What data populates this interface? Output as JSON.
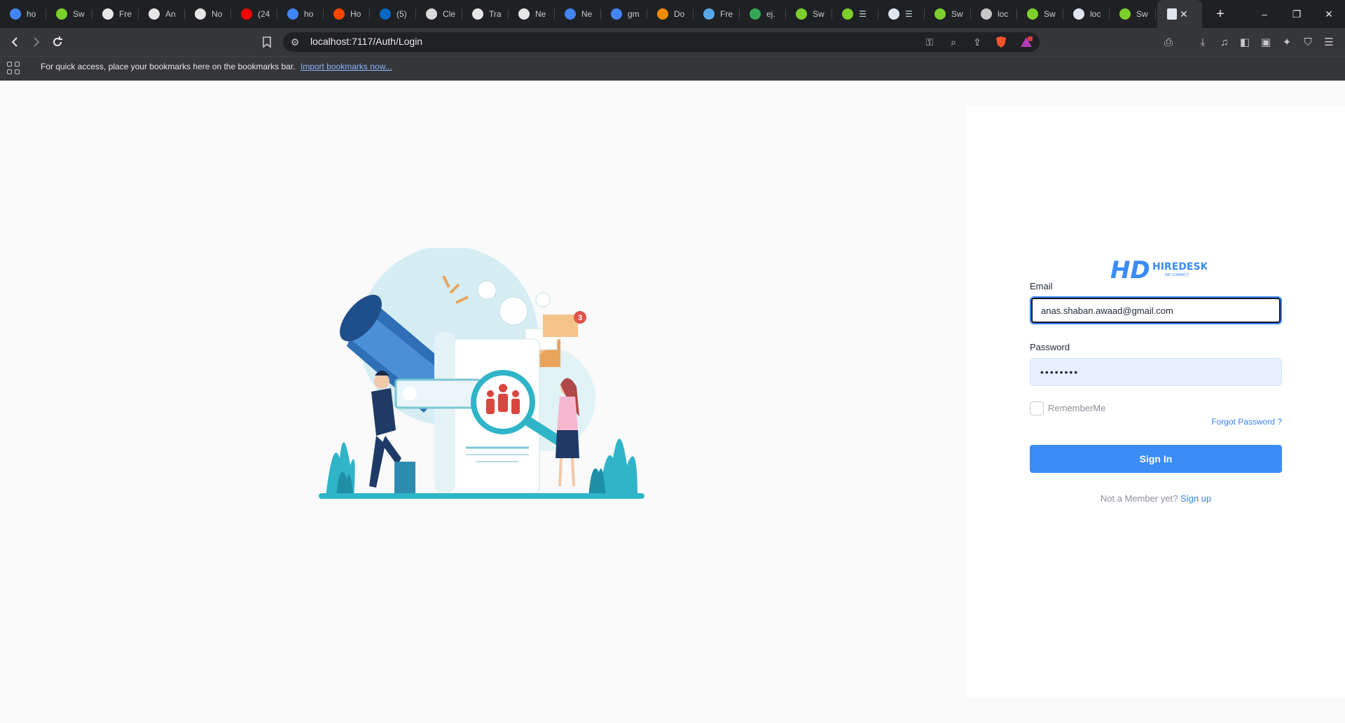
{
  "browser": {
    "tabs": [
      {
        "title": "ho",
        "icon": "google-icon",
        "color": "#4285f4"
      },
      {
        "title": "Sw",
        "icon": "swagger-icon",
        "color": "#7ccf2c"
      },
      {
        "title": "Fre",
        "icon": "github-icon",
        "color": "#e6e6e6"
      },
      {
        "title": "An",
        "icon": "github-icon",
        "color": "#e6e6e6"
      },
      {
        "title": "No",
        "icon": "github-icon",
        "color": "#e6e6e6"
      },
      {
        "title": "(24",
        "icon": "youtube-icon",
        "color": "#ff0000"
      },
      {
        "title": "ho",
        "icon": "google-icon",
        "color": "#4285f4"
      },
      {
        "title": "Ho",
        "icon": "reddit-icon",
        "color": "#ff4500"
      },
      {
        "title": "(5)",
        "icon": "linkedin-icon",
        "color": "#0a66c2"
      },
      {
        "title": "Cle",
        "icon": "chatgpt-icon",
        "color": "#d9d9d9"
      },
      {
        "title": "Tra",
        "icon": "github-icon",
        "color": "#e6e6e6"
      },
      {
        "title": "Ne",
        "icon": "github-icon",
        "color": "#e6e6e6"
      },
      {
        "title": "Ne",
        "icon": "docs-icon",
        "color": "#4285f4"
      },
      {
        "title": "gm",
        "icon": "google-icon",
        "color": "#4285f4"
      },
      {
        "title": "Do",
        "icon": "vlc-icon",
        "color": "#f08a00"
      },
      {
        "title": "Fre",
        "icon": "eye-icon",
        "color": "#5aa9e6"
      },
      {
        "title": "ej.",
        "icon": "drive-icon",
        "color": "#34a853"
      },
      {
        "title": "Sw",
        "icon": "swagger-icon",
        "color": "#7ccf2c"
      },
      {
        "title": "☰",
        "icon": "swagger-icon",
        "color": "#7ccf2c"
      },
      {
        "title": "☰",
        "icon": "page-icon",
        "color": "#dfe6f0"
      },
      {
        "title": "Sw",
        "icon": "swagger-icon",
        "color": "#7ccf2c"
      },
      {
        "title": "loc",
        "icon": "globe-icon",
        "color": "#c7c7c7"
      },
      {
        "title": "Sw",
        "icon": "swagger-icon",
        "color": "#7ccf2c"
      },
      {
        "title": "loc",
        "icon": "page-icon",
        "color": "#dfe6f0"
      },
      {
        "title": "Sw",
        "icon": "swagger-icon",
        "color": "#7ccf2c"
      }
    ],
    "active_tab_icon": "page-icon",
    "new_tab_label": "+",
    "window_controls": {
      "minimize": "–",
      "restore": "❐",
      "close": "✕"
    },
    "url": "localhost:7117/Auth/Login",
    "bookmarks_bar": {
      "message": "For quick access, place your bookmarks here on the bookmarks bar.",
      "link": "Import bookmarks now..."
    }
  },
  "illustration": {
    "notification_count": "3"
  },
  "login": {
    "brand": "HIREDESK",
    "logo_mark": "HD",
    "tagline": "WE CONNECT",
    "email_label": "Email",
    "email_value": "anas.shaban.awaad@gmail.com",
    "password_label": "Password",
    "password_value": "••••••••",
    "remember_label": "RememberMe",
    "forgot_label": "Forgot Password ?",
    "signin_label": "Sign In",
    "member_text": "Not a Member yet?",
    "signup_label": "Sign up"
  },
  "colors": {
    "accent": "#3b82f6",
    "button": "#3b8df5",
    "teal": "#2fb4c8"
  }
}
